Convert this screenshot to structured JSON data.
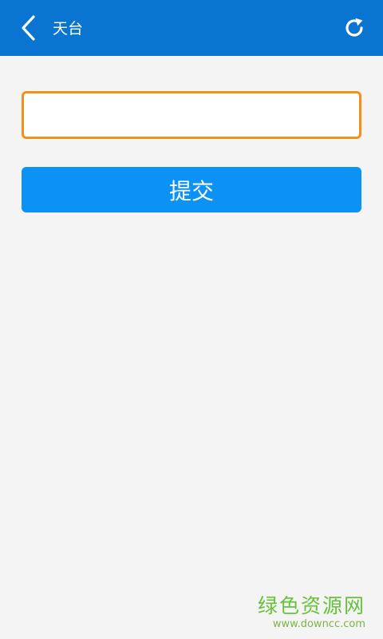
{
  "header": {
    "title": "天台",
    "back_icon": "chevron-left-icon",
    "refresh_icon": "refresh-icon",
    "bg_color": "#0a74d1"
  },
  "form": {
    "input_value": "",
    "input_placeholder": "",
    "input_border_color": "#f29116",
    "submit_label": "提交",
    "submit_color": "#0c92f4"
  },
  "watermark": {
    "text_cn": "绿色资源网",
    "text_en": "www.downcc.com",
    "color": "#66c23a"
  }
}
